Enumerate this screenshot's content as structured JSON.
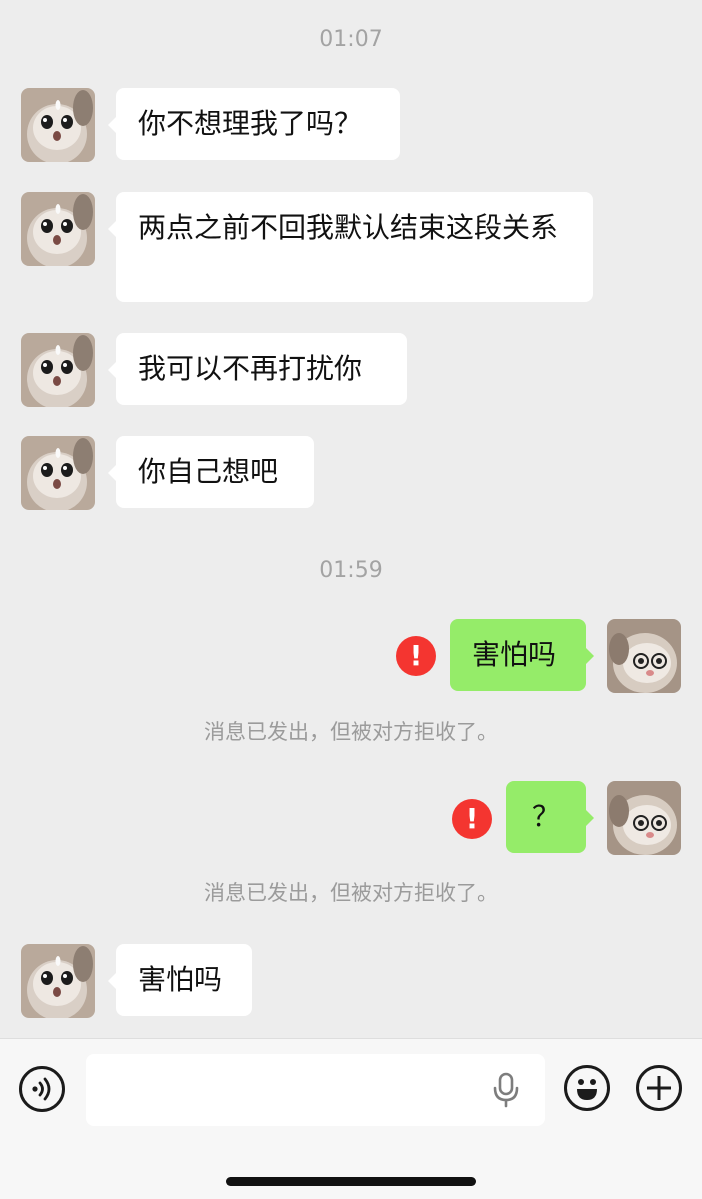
{
  "timestamps": [
    "01:07",
    "01:59"
  ],
  "messages": {
    "m1": "你不想理我了吗？",
    "m2": "两点之前不回我默认结束这段关系",
    "m3": "我可以不再打扰你",
    "m4": "你自己想吧",
    "m5": "害怕吗",
    "m6": "？",
    "m7": "害怕吗"
  },
  "notices": {
    "rejected": "消息已发出，但被对方拒收了。"
  },
  "error_icon_glyph": "!",
  "colors": {
    "sent_bubble": "#95ec69",
    "received_bubble": "#ffffff",
    "error": "#f43530",
    "background": "#ededed"
  },
  "input_bar": {
    "value": "",
    "icons": [
      "voice-icon",
      "microphone-icon",
      "emoji-icon",
      "plus-icon"
    ]
  }
}
